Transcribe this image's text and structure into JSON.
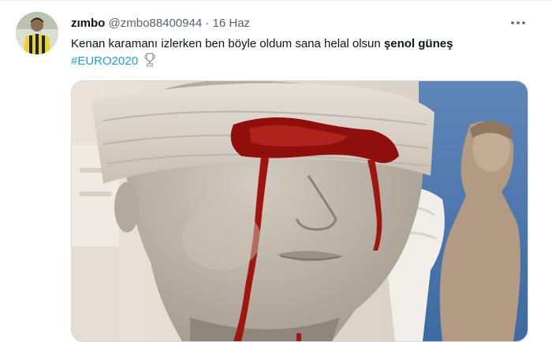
{
  "tweet": {
    "display_name": "zımbo",
    "handle": "@zmbo88400944",
    "separator": "·",
    "date": "16 Haz",
    "more_icon": "more-dots-icon",
    "text_plain": "Kenan karamanı izlerken ben böyle oldum sana helal olsun ",
    "text_bold": "şenol güneş",
    "hashtag": "#EURO2020",
    "hashtag_emoji_icon": "trophy-icon",
    "media_description_icon": "statue-photo"
  },
  "colors": {
    "link": "#1d9bf0",
    "secondary_text": "#536471",
    "primary_text": "#0f1419",
    "blood_red": "#9b1410"
  }
}
